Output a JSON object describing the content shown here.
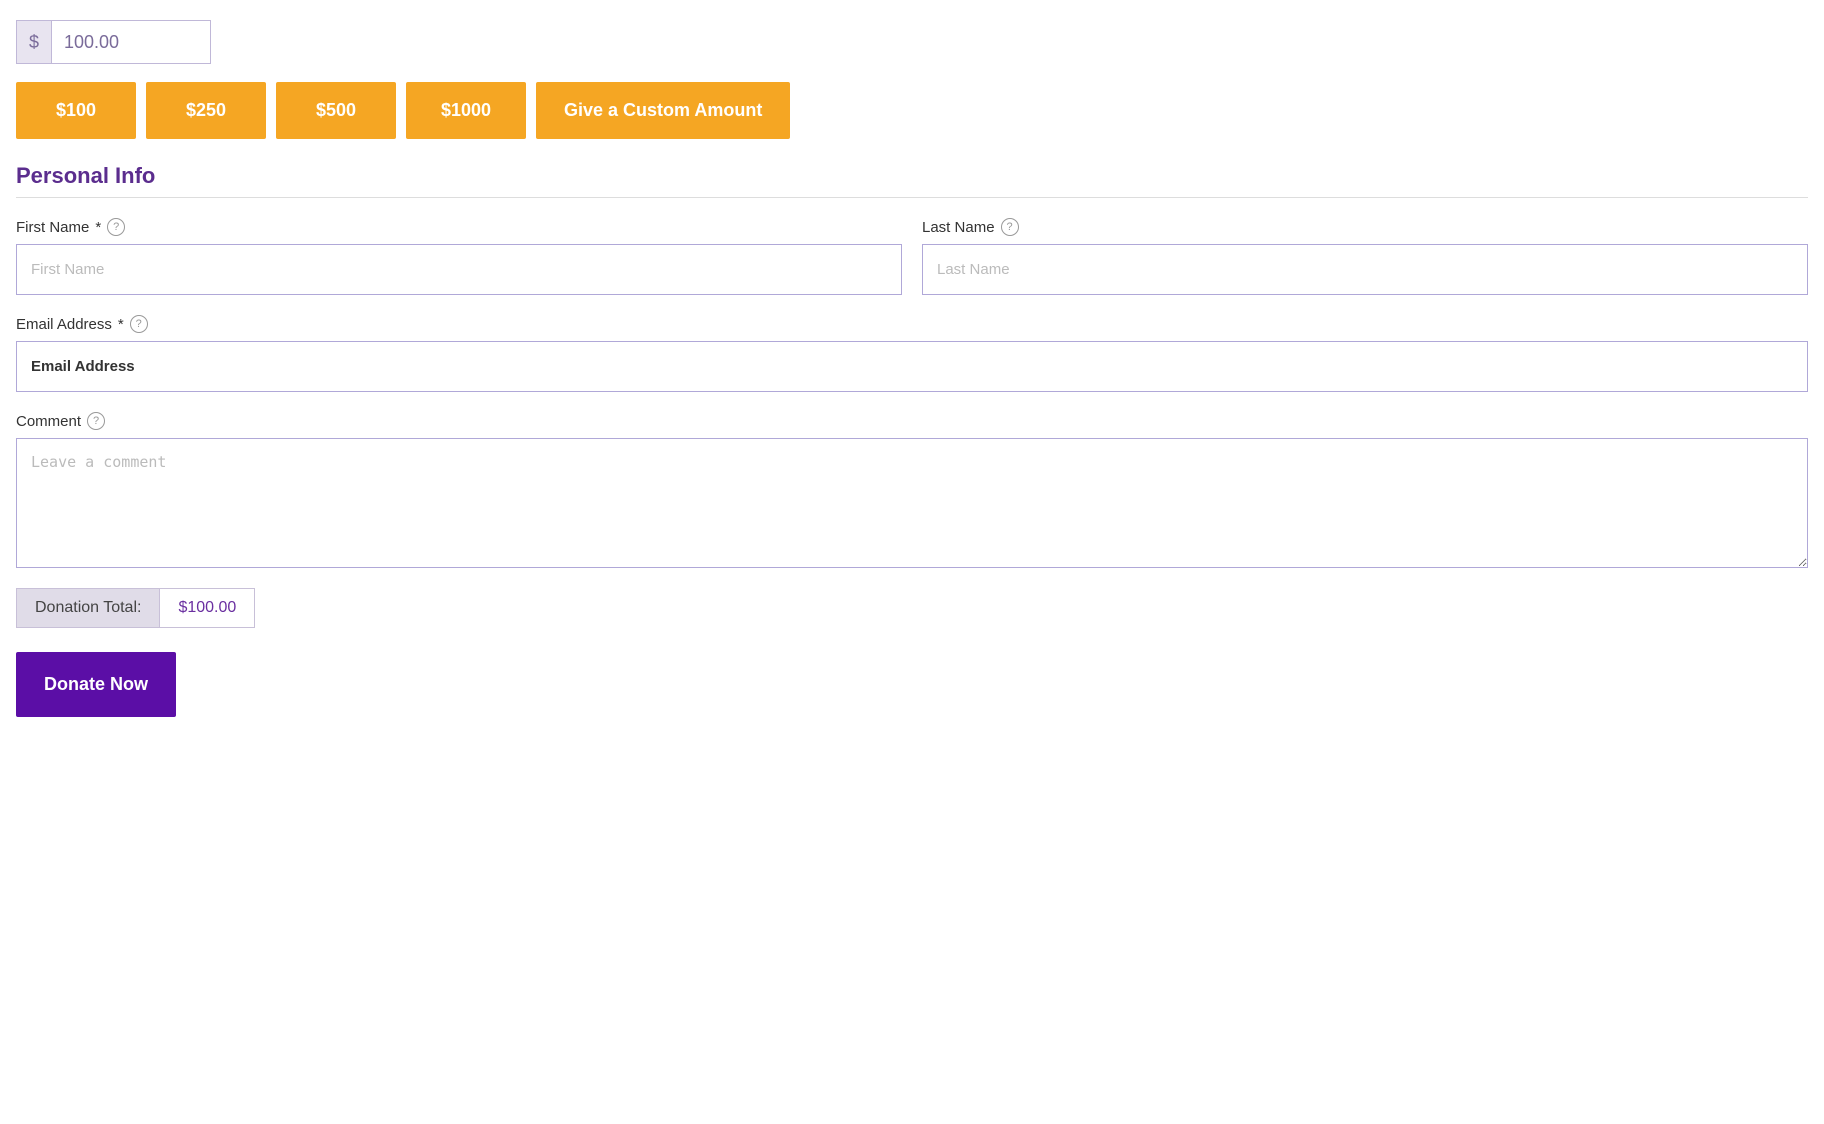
{
  "amount_input": {
    "dollar_sign": "$",
    "value": "100.00"
  },
  "preset_buttons": [
    {
      "id": "btn-100",
      "label": "$100"
    },
    {
      "id": "btn-250",
      "label": "$250"
    },
    {
      "id": "btn-500",
      "label": "$500"
    },
    {
      "id": "btn-1000",
      "label": "$1000"
    },
    {
      "id": "btn-custom",
      "label": "Give a Custom Amount",
      "is_custom": true
    }
  ],
  "personal_info": {
    "title": "Personal Info",
    "first_name": {
      "label": "First Name",
      "required": true,
      "placeholder": "First Name"
    },
    "last_name": {
      "label": "Last Name",
      "required": false,
      "placeholder": "Last Name"
    },
    "email": {
      "label": "Email Address",
      "required": true,
      "value": "Email Address"
    },
    "comment": {
      "label": "Comment",
      "placeholder": "Leave a comment"
    }
  },
  "donation_total": {
    "label": "Donation Total:",
    "value": "$100.00"
  },
  "donate_button": {
    "label": "Donate Now"
  },
  "colors": {
    "accent_purple": "#5b0ea6",
    "title_purple": "#5b2d8e",
    "orange": "#f5a623"
  }
}
